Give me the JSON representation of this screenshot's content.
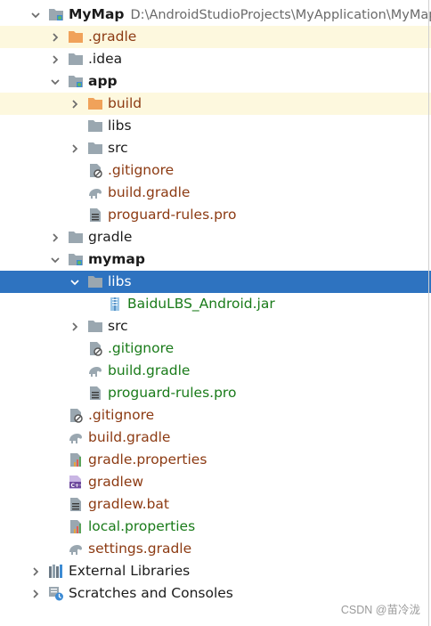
{
  "project": {
    "name": "MyMap",
    "path": "D:\\AndroidStudioProjects\\MyApplication\\MyMap"
  },
  "tree": [
    {
      "label": "MyMap",
      "depth": 0,
      "arrow": "down",
      "icon": "module-folder-icon",
      "color": "black",
      "bold": true,
      "path": true
    },
    {
      "label": ".gradle",
      "depth": 1,
      "arrow": "right",
      "icon": "excluded-folder-icon",
      "color": "brown",
      "hl": true
    },
    {
      "label": ".idea",
      "depth": 1,
      "arrow": "right",
      "icon": "folder-icon",
      "color": "black"
    },
    {
      "label": "app",
      "depth": 1,
      "arrow": "down",
      "icon": "module-folder-icon",
      "color": "black",
      "bold": true
    },
    {
      "label": "build",
      "depth": 2,
      "arrow": "right",
      "icon": "excluded-folder-icon",
      "color": "brown",
      "hl": true
    },
    {
      "label": "libs",
      "depth": 2,
      "arrow": "none",
      "icon": "folder-icon",
      "color": "black"
    },
    {
      "label": "src",
      "depth": 2,
      "arrow": "right",
      "icon": "folder-icon",
      "color": "black"
    },
    {
      "label": ".gitignore",
      "depth": 2,
      "arrow": "none",
      "icon": "ignore-file-icon",
      "color": "brown"
    },
    {
      "label": "build.gradle",
      "depth": 2,
      "arrow": "none",
      "icon": "gradle-elephant-icon",
      "color": "brown"
    },
    {
      "label": "proguard-rules.pro",
      "depth": 2,
      "arrow": "none",
      "icon": "text-file-icon",
      "color": "brown"
    },
    {
      "label": "gradle",
      "depth": 1,
      "arrow": "right",
      "icon": "folder-icon",
      "color": "black"
    },
    {
      "label": "mymap",
      "depth": 1,
      "arrow": "down",
      "icon": "module-folder-icon",
      "color": "black",
      "bold": true
    },
    {
      "label": "libs",
      "depth": 2,
      "arrow": "down",
      "icon": "folder-icon",
      "color": "white",
      "sel": true
    },
    {
      "label": "BaiduLBS_Android.jar",
      "depth": 3,
      "arrow": "none",
      "icon": "jar-file-icon",
      "color": "green"
    },
    {
      "label": "src",
      "depth": 2,
      "arrow": "right",
      "icon": "folder-icon",
      "color": "black"
    },
    {
      "label": ".gitignore",
      "depth": 2,
      "arrow": "none",
      "icon": "ignore-file-icon",
      "color": "green"
    },
    {
      "label": "build.gradle",
      "depth": 2,
      "arrow": "none",
      "icon": "gradle-elephant-icon",
      "color": "green"
    },
    {
      "label": "proguard-rules.pro",
      "depth": 2,
      "arrow": "none",
      "icon": "text-file-icon",
      "color": "green"
    },
    {
      "label": ".gitignore",
      "depth": 1,
      "arrow": "none",
      "icon": "ignore-file-icon",
      "color": "brown"
    },
    {
      "label": "build.gradle",
      "depth": 1,
      "arrow": "none",
      "icon": "gradle-elephant-icon",
      "color": "brown"
    },
    {
      "label": "gradle.properties",
      "depth": 1,
      "arrow": "none",
      "icon": "properties-file-icon",
      "color": "brown"
    },
    {
      "label": "gradlew",
      "depth": 1,
      "arrow": "none",
      "icon": "shell-script-icon",
      "color": "brown"
    },
    {
      "label": "gradlew.bat",
      "depth": 1,
      "arrow": "none",
      "icon": "text-file-icon",
      "color": "brown"
    },
    {
      "label": "local.properties",
      "depth": 1,
      "arrow": "none",
      "icon": "properties-file-icon",
      "color": "green"
    },
    {
      "label": "settings.gradle",
      "depth": 1,
      "arrow": "none",
      "icon": "gradle-elephant-icon",
      "color": "brown"
    },
    {
      "label": "External Libraries",
      "depth": 0,
      "arrow": "right",
      "icon": "libraries-icon",
      "color": "black"
    },
    {
      "label": "Scratches and Consoles",
      "depth": 0,
      "arrow": "right",
      "icon": "scratches-icon",
      "color": "black"
    }
  ],
  "watermark": "CSDN @苗冷泷"
}
